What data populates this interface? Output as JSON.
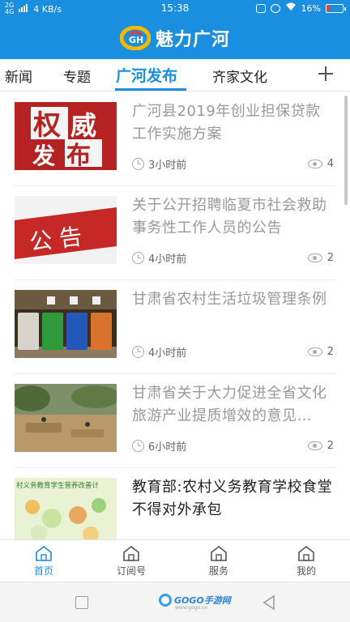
{
  "status_bar": {
    "network": "4 KB/s",
    "signal_labels": [
      "2G",
      "4G"
    ],
    "time": "15:38",
    "battery": "16%"
  },
  "header": {
    "title": "魅力广河",
    "logo_icon": "gh-logo-icon",
    "colors": {
      "primary": "#1a8fe0",
      "accent_logo": "#f5b800"
    }
  },
  "tabs": {
    "items": [
      "新闻",
      "专题",
      "广河发布",
      "齐家文化"
    ],
    "active": "广河发布",
    "add_icon": "plus-icon"
  },
  "feed": [
    {
      "title": "广河县2019年创业担保贷款工作实施方案",
      "time": "3小时前",
      "views": "4",
      "thumb": "权威发布",
      "read": true
    },
    {
      "title": "关于公开招聘临夏市社会救助事务性工作人员的公告",
      "time": "4小时前",
      "views": "2",
      "thumb": "公告",
      "read": true
    },
    {
      "title": "甘肃省农村生活垃圾管理条例",
      "time": "4小时前",
      "views": "2",
      "thumb": "",
      "read": true
    },
    {
      "title": "甘肃省关于大力促进全省文化旅游产业提质增效的意见…",
      "time": "6小时前",
      "views": "2",
      "thumb": "",
      "read": true
    },
    {
      "title": "教育部:农村义务教育学校食堂不得对外承包",
      "time": "",
      "views": "",
      "thumb": "村义务教育学生营养改善计",
      "read": false
    }
  ],
  "bottom_nav": {
    "items": [
      "首页",
      "订阅号",
      "服务",
      "我的"
    ],
    "active": "首页"
  },
  "watermark": {
    "brand": "GOGO手游网",
    "url": "www.gogo.cn"
  }
}
